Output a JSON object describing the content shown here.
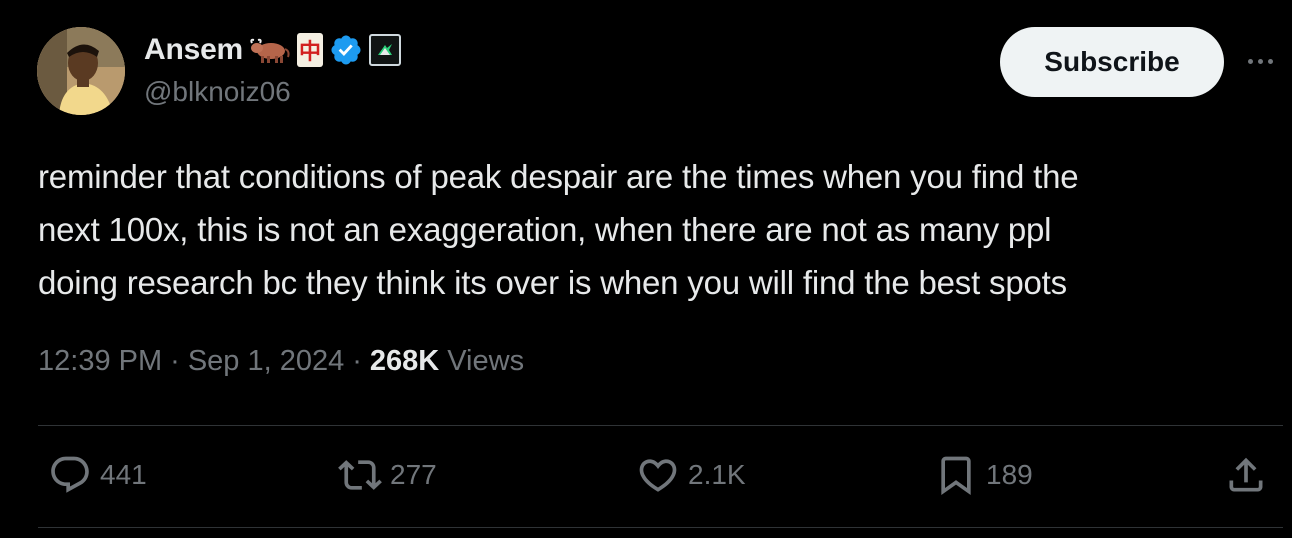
{
  "author": {
    "display_name": "Ansem",
    "handle": "@blknoiz06",
    "name_emojis": [
      "ox-emoji",
      "mahjong-red-dragon-emoji"
    ],
    "mahjong_char": "中",
    "badges": [
      "verified-badge-icon",
      "affiliate-badge-icon"
    ]
  },
  "header": {
    "subscribe_label": "Subscribe",
    "more_icon": "more-icon"
  },
  "tweet": {
    "text": "reminder that conditions of peak despair are the times when you find the\nnext 100x, this is not an exaggeration, when there are not as many ppl\ndoing research bc they think its over is when you will find the best spots",
    "time": "12:39 PM",
    "date": "Sep 1, 2024",
    "separator": "·",
    "views_count": "268K",
    "views_label": "Views"
  },
  "actions": {
    "reply": {
      "icon": "reply-icon",
      "count": "441"
    },
    "repost": {
      "icon": "repost-icon",
      "count": "277"
    },
    "like": {
      "icon": "heart-icon",
      "count": "2.1K"
    },
    "bookmark": {
      "icon": "bookmark-icon",
      "count": "189"
    },
    "share": {
      "icon": "share-icon"
    }
  },
  "colors": {
    "background": "#000000",
    "text_primary": "#e7e9ea",
    "text_secondary": "#71767b",
    "verified_blue": "#1d9bf0",
    "subscribe_bg": "#eff3f4",
    "divider": "#2f3336"
  }
}
